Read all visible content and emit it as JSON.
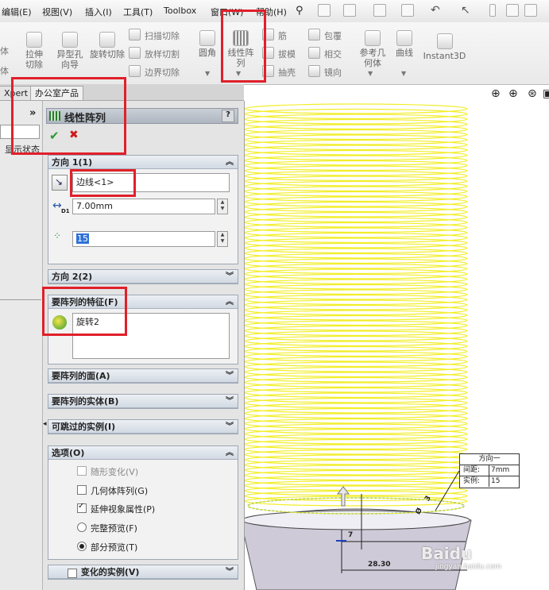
{
  "menubar": {
    "items": [
      "编辑(E)",
      "视图(V)",
      "插入(I)",
      "工具(T)",
      "Toolbox",
      "窗口(W)",
      "帮助(H)"
    ]
  },
  "ribbon": {
    "left_cut": [
      "体",
      "体"
    ],
    "buttons": {
      "extrude_cut": "拉伸切除",
      "hole_wizard": "异型孔向导",
      "revolve_cut": "旋转切除",
      "fillet": "圆角",
      "linear_pattern": "线性阵列",
      "ref_geometry": "参考几何体",
      "curves": "曲线",
      "instant3d": "Instant3D"
    },
    "small": {
      "swept_cut": "扫描切除",
      "loft_cut": "放样切割",
      "boundary_cut": "边界切除",
      "rib": "筋",
      "draft": "拔模",
      "shell": "抽壳",
      "wrap": "包覆",
      "intersect": "相交",
      "mirror": "镜向"
    }
  },
  "tabs": {
    "xpert": "Xpert",
    "office": "办公室产品"
  },
  "leftpanel": {
    "chevron": "»",
    "display_state": "显示状态"
  },
  "pm": {
    "title": "线性阵列",
    "help": "?",
    "ok": "✔",
    "cancel": "✖",
    "dir1": {
      "label": "方向 1(1)",
      "edge": "边线<1>",
      "spacing": "7.00mm",
      "count": "15",
      "d1": "D1"
    },
    "dir2": {
      "label": "方向 2(2)"
    },
    "features": {
      "label": "要阵列的特征(F)",
      "item": "旋转2"
    },
    "faces": {
      "label": "要阵列的面(A)"
    },
    "bodies": {
      "label": "要阵列的实体(B)"
    },
    "skip": {
      "label": "可跳过的实例(I)"
    },
    "options": {
      "label": "选项(O)",
      "items": [
        "随形变化(V)",
        "几何体阵列(G)",
        "延伸视象属性(P)",
        "完整预览(F)",
        "部分预览(T)"
      ]
    },
    "varying": {
      "label": "变化的实例(V)"
    }
  },
  "viewport": {
    "callout": {
      "title": "方向一",
      "spacing_label": "间距:",
      "spacing": "7mm",
      "count_label": "实例:",
      "count": "15"
    },
    "dim_283": "28.30",
    "dim_7": "7",
    "dim_3": "3",
    "dim_0": "Ø"
  },
  "watermark": {
    "brand": "Baidu",
    "url": "jingyan.baidu.com"
  },
  "colors": {
    "highlight": "#e0202a",
    "preview": "#f2ee2a",
    "group_header": "#d2d9e2",
    "accept": "#2f9a2f",
    "reject": "#d01818"
  }
}
